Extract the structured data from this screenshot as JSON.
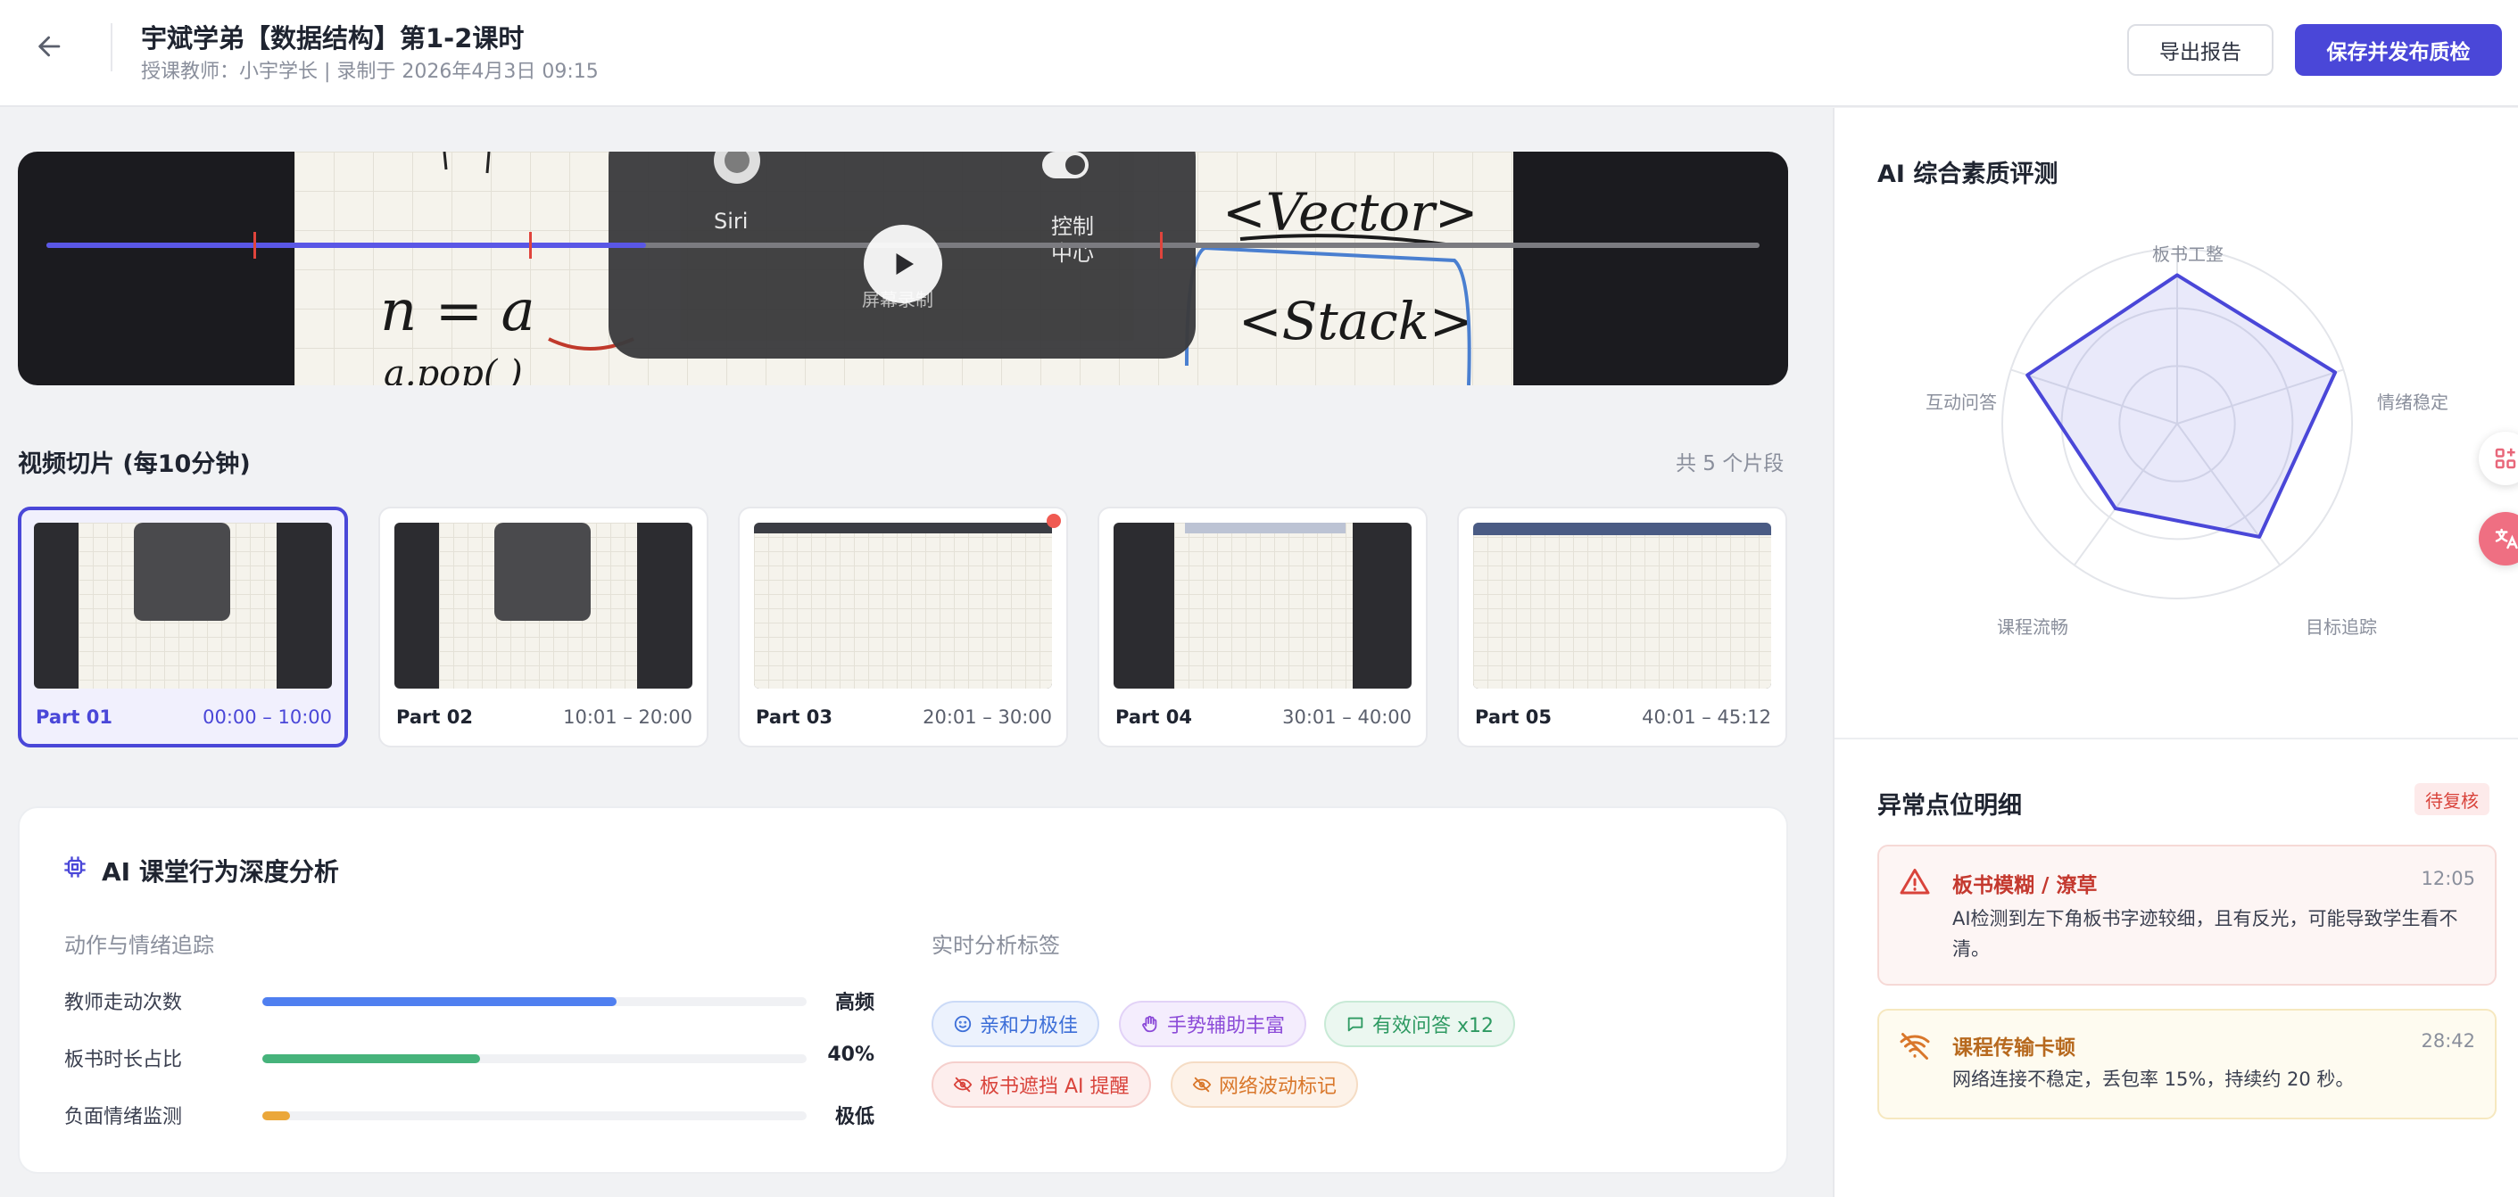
{
  "header": {
    "title": "宇斌学弟【数据结构】第1-2课时",
    "subtitle": "授课教师：小宇学长 | 录制于 2026年4月3日 09:15",
    "export_label": "导出报告",
    "publish_label": "保存并发布质检"
  },
  "video": {
    "progress_fraction": 0.35,
    "marker_fractions": [
      0.121,
      0.282,
      0.65
    ],
    "overlay_labels": {
      "siri": "Siri",
      "control_1": "控制",
      "control_2": "中心",
      "screen": "屏幕录制"
    },
    "accent_color": "#5a57e6",
    "marker_color": "#e0443c"
  },
  "clips": {
    "title": "视频切片 (每10分钟)",
    "count_label": "共 5 个片段",
    "items": [
      {
        "name": "Part 01",
        "time": "00:00 – 10:00",
        "active": true
      },
      {
        "name": "Part 02",
        "time": "10:01 – 20:00",
        "active": false
      },
      {
        "name": "Part 03",
        "time": "20:01 – 30:00",
        "active": false
      },
      {
        "name": "Part 04",
        "time": "30:01 – 40:00",
        "active": false
      },
      {
        "name": "Part 05",
        "time": "40:01 – 45:12",
        "active": false
      }
    ]
  },
  "analysis": {
    "title": "AI 课堂行为深度分析",
    "left_heading": "动作与情绪追踪",
    "right_heading": "实时分析标签",
    "metrics": [
      {
        "label": "教师走动次数",
        "value": "高频",
        "fraction": 0.65,
        "color": "#4f7ff0"
      },
      {
        "label": "板书时长占比",
        "value": "40%",
        "fraction": 0.4,
        "color": "#46b37b"
      },
      {
        "label": "负面情绪监测",
        "value": "极低",
        "fraction": 0.05,
        "color": "#eba73a"
      }
    ],
    "tags": [
      {
        "label": "亲和力极佳",
        "icon": "smile-icon",
        "color": "#3d6fd8",
        "bg": "#ecf2fd",
        "border": "#cbdaf7"
      },
      {
        "label": "手势辅助丰富",
        "icon": "hand-icon",
        "color": "#8b4ad8",
        "bg": "#f4edfd",
        "border": "#e2d2f7"
      },
      {
        "label": "有效问答 x12",
        "icon": "chat-icon",
        "color": "#2e9a62",
        "bg": "#ebf7f0",
        "border": "#c8ead6"
      },
      {
        "label": "板书遮挡 AI 提醒",
        "icon": "eye-off-icon",
        "color": "#d9433b",
        "bg": "#fdeeed",
        "border": "#f5cfcc"
      },
      {
        "label": "网络波动标记",
        "icon": "eye-off-icon",
        "color": "#d9772b",
        "bg": "#fdf2e8",
        "border": "#f5dcc4"
      }
    ]
  },
  "radar": {
    "title": "AI 综合素质评测",
    "axes": [
      {
        "label": "板书工整",
        "value": 0.85
      },
      {
        "label": "情绪稳定",
        "value": 0.95
      },
      {
        "label": "目标追踪",
        "value": 0.8
      },
      {
        "label": "课程流畅",
        "value": 0.6
      },
      {
        "label": "互动问答",
        "value": 0.9
      }
    ],
    "color": "#4a47d8"
  },
  "anomalies": {
    "title": "异常点位明细",
    "badge": "待复核",
    "items": [
      {
        "title": "板书模糊 / 潦草",
        "time": "12:05",
        "desc": "AI检测到左下角板书字迹较细，且有反光，可能导致学生看不清。",
        "icon": "warning-icon"
      },
      {
        "title": "课程传输卡顿",
        "time": "28:42",
        "desc": "网络连接不稳定，丢包率 15%，持续约 20 秒。",
        "icon": "wifi-off-icon"
      }
    ]
  }
}
